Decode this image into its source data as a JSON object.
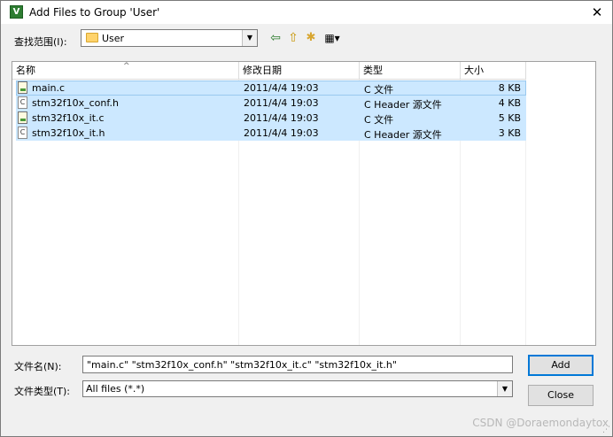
{
  "window": {
    "title": "Add Files to Group 'User'",
    "close_glyph": "✕"
  },
  "lookin": {
    "label": "查找范围(I):",
    "value": "User"
  },
  "toolbar": {
    "back": "⇦",
    "up": "⇧",
    "new_folder": "✱",
    "view": "▦▾"
  },
  "list": {
    "headers": [
      "名称",
      "修改日期",
      "类型",
      "大小"
    ],
    "rows": [
      {
        "name": "main.c",
        "date": "2011/4/4 19:03",
        "type": "C 文件",
        "size": "8 KB",
        "icon": "c-source-file-icon"
      },
      {
        "name": "stm32f10x_conf.h",
        "date": "2011/4/4 19:03",
        "type": "C Header 源文件",
        "size": "4 KB",
        "icon": "c-header-file-icon"
      },
      {
        "name": "stm32f10x_it.c",
        "date": "2011/4/4 19:03",
        "type": "C 文件",
        "size": "5 KB",
        "icon": "c-source-file-icon"
      },
      {
        "name": "stm32f10x_it.h",
        "date": "2011/4/4 19:03",
        "type": "C Header 源文件",
        "size": "3 KB",
        "icon": "c-header-file-icon"
      }
    ]
  },
  "filename": {
    "label": "文件名(N):",
    "value": "\"main.c\" \"stm32f10x_conf.h\" \"stm32f10x_it.c\" \"stm32f10x_it.h\""
  },
  "filetype": {
    "label": "文件类型(T):",
    "value": "All files (*.*)"
  },
  "buttons": {
    "add": "Add",
    "close": "Close"
  },
  "watermark": "CSDN @Doraemondaytox",
  "colors": {
    "selection": "#cce8ff",
    "default_button_border": "#0078d7"
  }
}
